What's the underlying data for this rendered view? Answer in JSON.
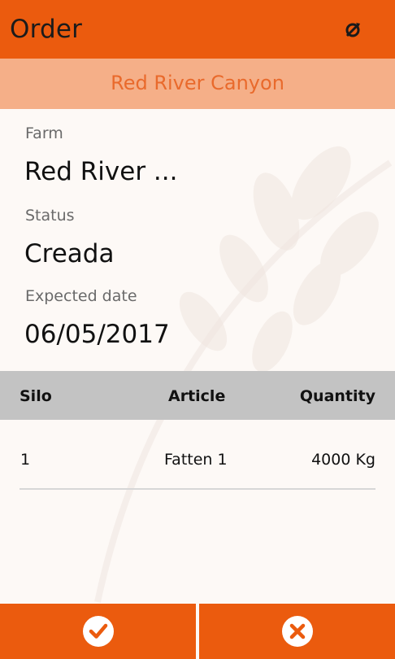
{
  "header": {
    "title": "Order",
    "icon": "sync-disabled-icon"
  },
  "subheader": {
    "title": "Red River Canyon"
  },
  "details": {
    "farm": {
      "label": "Farm",
      "value": "Red River ..."
    },
    "status": {
      "label": "Status",
      "value": "Creada"
    },
    "expected_date": {
      "label": "Expected date",
      "value": "06/05/2017"
    }
  },
  "table": {
    "columns": [
      "Silo",
      "Article",
      "Quantity"
    ],
    "rows": [
      {
        "silo": "1",
        "article": "Fatten 1",
        "quantity": "4000 Kg"
      }
    ]
  },
  "actions": [
    {
      "icon": "checkmark-icon"
    },
    {
      "icon": "close-icon"
    }
  ],
  "colors": {
    "accent": "#eb5b0e",
    "subheader_bg": "#f5af88",
    "subheader_text": "#e96a2c",
    "table_header_bg": "#c3c3c3"
  }
}
